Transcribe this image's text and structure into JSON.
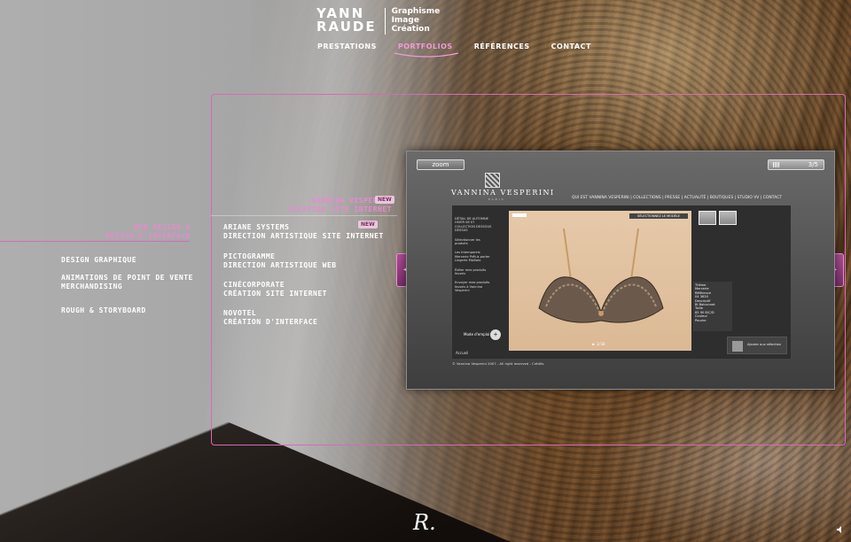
{
  "brand": {
    "name_line1": "YANN",
    "name_line2": "RAUDE",
    "tag_line1": "Graphisme",
    "tag_line2": "Image",
    "tag_line3": "Création"
  },
  "nav": [
    {
      "label": "PRESTATIONS",
      "active": false
    },
    {
      "label": "PORTFOLIOS",
      "active": true
    },
    {
      "label": "RÉFÉRENCES",
      "active": false
    },
    {
      "label": "CONTACT",
      "active": false
    }
  ],
  "categories": {
    "active_line1": "WEB DESIGN &",
    "active_line2": "DESIGN D'INTERFACE",
    "items": [
      "DESIGN GRAPHIQUE",
      "ANIMATIONS DE POINT DE VENTE",
      "MERCHANDISING",
      "ROUGH & STORYBOARD"
    ]
  },
  "projects": {
    "active": {
      "title": "VANNINA VESPERINI",
      "subtitle": "CRÉATION SITE INTERNET",
      "badge": "NEW"
    },
    "items": [
      {
        "title": "ARIANE SYSTEMS",
        "subtitle": "DIRECTION ARTISTIQUE SITE INTERNET",
        "badge": "NEW"
      },
      {
        "title": "PICTOGRAMME",
        "subtitle": "DIRECTION ARTISTIQUE WEB"
      },
      {
        "title": "CINÉCORPORATE",
        "subtitle": "CRÉATION SITE INTERNET"
      },
      {
        "title": "NOVOTEL",
        "subtitle": "CRÉATION D'INTERFACE"
      }
    ]
  },
  "preview": {
    "zoom_label": "zoom",
    "page_indicator": "3/5",
    "site": {
      "logo": "VANNINA VESPERINI",
      "logo_sub": "PARIS",
      "nav": "QUI EST VANNINA VESPERINI  |  COLLECTIONS  |  PRESSE  |  ACTUALITÉ  |  BOUTIQUES  |  STUDIO VV  |  CONTACT",
      "side_blocks": [
        "DÉTAIL DE AUTOMNE HIVER 06 07 COLLECTION DESSOUS DESSUS",
        "Sélectionner les produits",
        "Les Intemporels Mercerie Prêt-à-porter Lingerie Maillots",
        "Éditer mes produits favoris",
        "Envoyer mes produits favoris à Vannina Vesperini"
      ],
      "select_label": "SÉLECTIONNEZ LE MODÈLE",
      "mode_label": "Mode d'emploi",
      "mode_icon": "+",
      "spec": [
        "Thème",
        "Mercerie",
        "Référence",
        "04 3630",
        "Descriptif",
        "Bi Balconnet",
        "Taille",
        "85 90 B/C/D",
        "Couleur",
        "Poudre"
      ],
      "cart_label": "Ajouter aux sélection",
      "small_label": "Accueil",
      "footer": "© Vannina Vesperini 2007 - All right reserved  -  Crédits",
      "dots": "●   1/10"
    }
  },
  "signature": "R."
}
